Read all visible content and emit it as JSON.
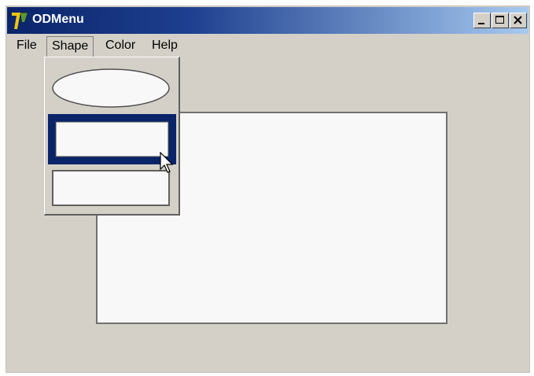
{
  "window": {
    "title": "ODMenu",
    "controls": {
      "minimize": "minimize",
      "maximize": "maximize",
      "close": "close"
    }
  },
  "menubar": {
    "items": [
      {
        "label": "File"
      },
      {
        "label": "Shape",
        "open": true
      },
      {
        "label": "Color"
      },
      {
        "label": "Help"
      }
    ]
  },
  "shape_menu": {
    "items": [
      {
        "icon": "ellipse-icon",
        "selected": false
      },
      {
        "icon": "rectangle-icon",
        "selected": true
      },
      {
        "icon": "rectangle-icon",
        "selected": false
      }
    ]
  },
  "colors": {
    "titlebar_start": "#0a246a",
    "titlebar_end": "#a6caf0",
    "highlight": "#0a246a",
    "face": "#d4d0c8"
  }
}
